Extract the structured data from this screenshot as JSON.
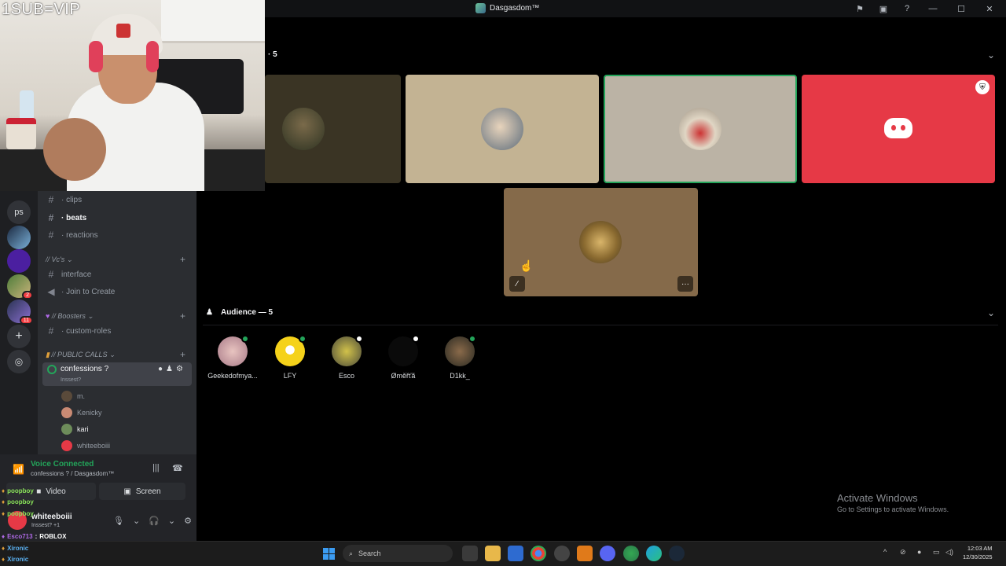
{
  "window": {
    "title": "Dasgasdom™"
  },
  "webcam": {
    "overlay_text": "1SUB=VIP"
  },
  "servers": [
    {
      "label": "ps"
    },
    {
      "label": "",
      "badge": "2"
    },
    {
      "label": "",
      "badge": "11"
    }
  ],
  "channels": {
    "clips": "clips",
    "beats": "beats",
    "reactions": "reactions",
    "vcs_category": "// Vc's",
    "interface": "interface",
    "join_to_create": "Join to Create",
    "boosters_category": "// Boosters",
    "custom_roles": "custom-roles",
    "public_calls_category": "// PUBLIC CALLS",
    "confessions": "confessions ?",
    "confessions_sub": "Inssest?",
    "voice_users": [
      "m.",
      "Kenicky",
      "kari",
      "whiteeboiii"
    ]
  },
  "voice_panel": {
    "status": "Voice Connected",
    "location": "confessions ? / Dasgasdom™",
    "video_label": "Video",
    "screen_label": "Screen",
    "username": "whiteeboiii",
    "user_sub": "Inssest? +1"
  },
  "stage": {
    "speakers_label": "5",
    "audience_label": "Audience — 5"
  },
  "audience": [
    {
      "name": "Geekedofmya...",
      "status_color": "#23a55a"
    },
    {
      "name": "LFY",
      "status_color": "#23a55a"
    },
    {
      "name": "Esco",
      "status_color": "#ffffff"
    },
    {
      "name": "Øměřťã",
      "status_color": "#ffffff"
    },
    {
      "name": "D1kk_",
      "status_color": "#23a55a"
    }
  ],
  "chat_overlay": [
    {
      "user": "poopboy",
      "message": ""
    },
    {
      "user": "poopboy",
      "message": ""
    },
    {
      "user": "poopboy",
      "message": ""
    },
    {
      "user": "Esco713",
      "message": "ROBLOX"
    },
    {
      "user": "Xironic",
      "message": ""
    },
    {
      "user": "Xironic",
      "message": ""
    }
  ],
  "watermark": {
    "line1": "Activate Windows",
    "line2": "Go to Settings to activate Windows."
  },
  "taskbar": {
    "search_placeholder": "Search",
    "time": "12:03 AM",
    "date": "12/30/2025"
  },
  "colors": {
    "accent_green": "#23a55a",
    "discord_red": "#e63946",
    "tile_olive": "#3a3424",
    "tile_tan": "#c3b393",
    "tile_grey": "#bbb3a5",
    "tile_brown": "#856a4a"
  }
}
